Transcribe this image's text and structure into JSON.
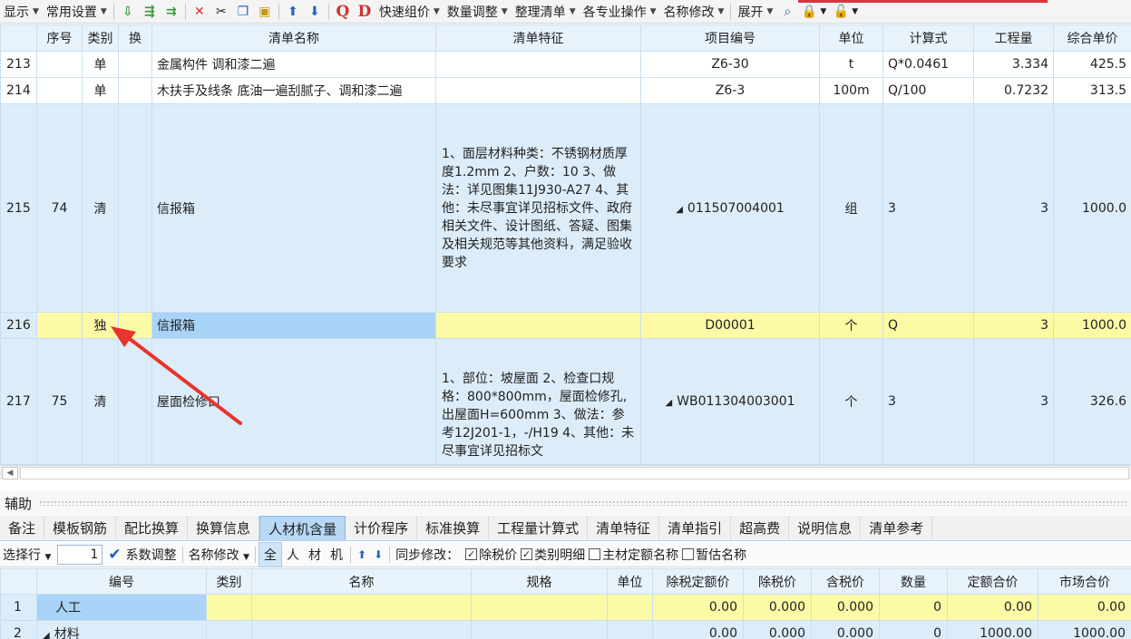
{
  "toolbar": {
    "display": "显示",
    "common_settings": "常用设置",
    "quick_pricing": "快速组价",
    "qty_adjust": "数量调整",
    "organize": "整理清单",
    "specialty_ops": "各专业操作",
    "rename": "名称修改",
    "expand": "展开"
  },
  "grid": {
    "columns": [
      "序号",
      "类别",
      "换",
      "清单名称",
      "清单特征",
      "项目编号",
      "单位",
      "计算式",
      "工程量",
      "综合单价"
    ],
    "rows": [
      {
        "idx": "213",
        "seq": "",
        "type": "单",
        "swap": "",
        "name": "金属构件 调和漆二遍",
        "feat": "",
        "code": "Z6-30",
        "unit": "t",
        "formula": "Q*0.0461",
        "qty": "3.334",
        "price": "425.5"
      },
      {
        "idx": "214",
        "seq": "",
        "type": "单",
        "swap": "",
        "name": "木扶手及线条 底油一遍刮腻子、调和漆二遍",
        "feat": "",
        "code": "Z6-3",
        "unit": "100m",
        "formula": "Q/100",
        "qty": "0.7232",
        "price": "313.5"
      },
      {
        "idx": "215",
        "seq": "74",
        "type": "清",
        "swap": "",
        "name": "信报箱",
        "feat": "1、面层材料种类：不锈钢材质厚度1.2mm\n2、户数：10\n3、做法：详见图集11J930-A27\n4、其他：未尽事宜详见招标文件、政府相关文件、设计图纸、答疑、图集及相关规范等其他资料，满足验收要求",
        "code": "011507004001",
        "unit": "组",
        "formula": "3",
        "qty": "3",
        "price": "1000.0"
      },
      {
        "idx": "216",
        "seq": "",
        "type": "独",
        "swap": "",
        "name": "信报箱",
        "feat": "",
        "code": "D00001",
        "unit": "个",
        "formula": "Q",
        "qty": "3",
        "price": "1000.0"
      },
      {
        "idx": "217",
        "seq": "75",
        "type": "清",
        "swap": "",
        "name": "屋面检修口",
        "feat": "1、部位：坡屋面\n2、检查口规格：800*800mm，屋面检修孔,出屋面H=600mm\n3、做法：参考12J201-1，-/H19\n4、其他：未尽事宜详见招标文",
        "code": "WB011304003001",
        "unit": "个",
        "formula": "3",
        "qty": "3",
        "price": "326.6"
      }
    ]
  },
  "aux": {
    "title": "辅助",
    "tabs": [
      "备注",
      "模板钢筋",
      "配比换算",
      "换算信息",
      "人材机含量",
      "计价程序",
      "标准换算",
      "工程量计算式",
      "清单特征",
      "清单指引",
      "超高费",
      "说明信息",
      "清单参考"
    ],
    "active_tab": "人材机含量"
  },
  "options": {
    "select_row": "选择行",
    "spin_value": "1",
    "coef_adjust": "系数调整",
    "rename": "名称修改",
    "seg": [
      "全",
      "人",
      "材",
      "机"
    ],
    "sync_label": "同步修改：",
    "chk_tax": "除税价",
    "chk_category": "类别明细",
    "chk_main_material": "主材定额名称",
    "chk_estimate": "暂估名称"
  },
  "lower": {
    "columns": [
      "编号",
      "类别",
      "名称",
      "规格",
      "单位",
      "除税定额价",
      "除税价",
      "含税价",
      "数量",
      "定额合价",
      "市场合价"
    ],
    "rows": [
      {
        "idx": "1",
        "code": "人工",
        "type": "",
        "name": "",
        "spec": "",
        "unit": "",
        "p1": "0.00",
        "p2": "0.000",
        "p3": "0.000",
        "qty": "0",
        "sum1": "0.00",
        "sum2": "0.00"
      },
      {
        "idx": "2",
        "code": "材料",
        "type": "",
        "name": "",
        "spec": "",
        "unit": "",
        "p1": "0.00",
        "p2": "0.000",
        "p3": "0.000",
        "qty": "0",
        "sum1": "1000.00",
        "sum2": "1000.00"
      }
    ]
  },
  "colors": {
    "accent": "#a9d3f7",
    "row_yellow": "#fdfaa6",
    "arrow": "#e8342d"
  }
}
